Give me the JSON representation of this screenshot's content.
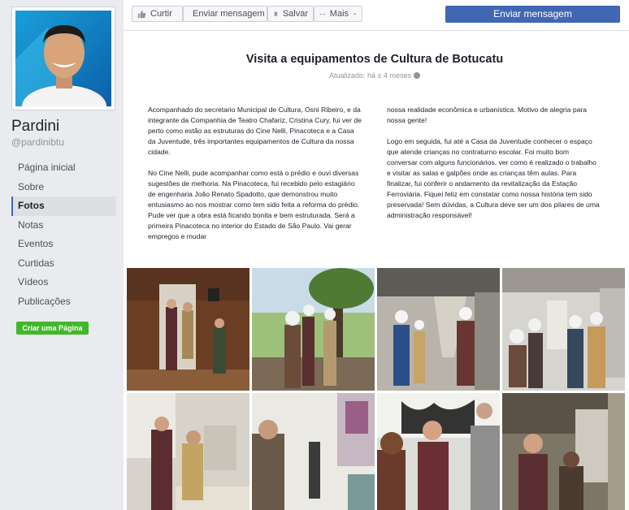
{
  "page": {
    "name": "Pardini",
    "handle": "@pardinibtu"
  },
  "nav": {
    "items": [
      {
        "label": "Página inicial"
      },
      {
        "label": "Sobre"
      },
      {
        "label": "Fotos"
      },
      {
        "label": "Notas"
      },
      {
        "label": "Eventos"
      },
      {
        "label": "Curtidas"
      },
      {
        "label": "Vídeos"
      },
      {
        "label": "Publicações"
      }
    ],
    "active": "Fotos",
    "create_page": "Criar uma Página"
  },
  "actions": {
    "like": "Curtir",
    "message": "Enviar mensagem",
    "save": "Salvar",
    "more": "Mais",
    "send_message": "Enviar mensagem"
  },
  "note": {
    "title": "Visita a equipamentos de Cultura de Botucatu",
    "updated": "Atualizado: há ± 4 meses",
    "left_paragraphs": [
      "Acompanhado do secretario Municipal de Cultura, Osni Ribeiro, e da integrante da Companhia de Teatro Chafariz, Cristina Cury, fui ver de perto como estão as estruturas do Cine Nelli, Pinacoteca e a Casa da Juventude, três importantes equipamentos de Cultura da nossa cidade.",
      "No Cine Nelli, pude acompanhar como está o prédio e ouvi diversas sugestões de melhoria. Na Pinacoteca, fui recebido pelo estagiário de engenharia João Renato Spadotto, que demonstrou muito entusiasmo ao nos mostrar como tem sido feita a reforma do prédio. Pude ver que a obra está ficando bonita e bem estruturada. Será a primeira Pinacoteca no interior do Estado de São Paulo. Vai gerar empregos e mudar"
    ],
    "right_paragraphs": [
      "nossa realidade econômica e urbanística. Motivo de alegria para nossa gente!",
      "Logo em seguida, fui até a Casa da Juventude conhecer o espaço que atende crianças no contraturno escolar. Foi muito bom conversar com alguns funcionários, ver como é realizado o trabalho e visitar as salas e galpões onde as crianças têm aulas. Para finalizar, fui conferir o andamento da revitalização da Estação Ferroviária. Fiquei feliz em constatar como nossa história tem sido preservada! Sem dúvidas, a Cultura deve ser um dos pilares de uma administração responsável!"
    ]
  },
  "photos": [
    {
      "name": "photo-cine-nelli"
    },
    {
      "name": "photo-pinacoteca-exterior"
    },
    {
      "name": "photo-corridor-construction"
    },
    {
      "name": "photo-construction-helmets"
    },
    {
      "name": "photo-plans-table"
    },
    {
      "name": "photo-gallery-paintings"
    },
    {
      "name": "photo-mural-conversation"
    },
    {
      "name": "photo-railway-station"
    }
  ],
  "colors": {
    "brand": "#4267b2",
    "green": "#42b72a",
    "bg": "#e9ebee"
  }
}
